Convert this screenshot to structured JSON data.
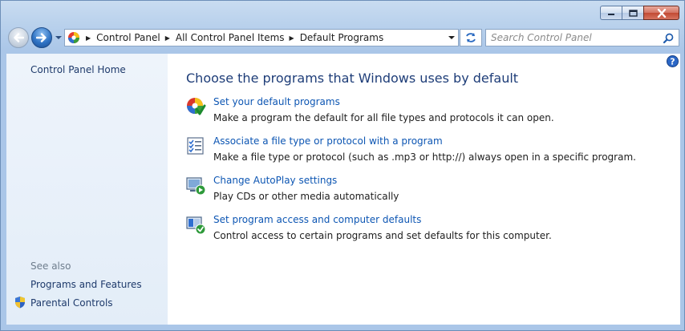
{
  "window": {
    "caption": {
      "minimize_icon": "minimize-icon",
      "maximize_icon": "maximize-icon",
      "close_icon": "close-icon"
    }
  },
  "navigation": {
    "back_icon": "back-arrow-icon",
    "forward_icon": "forward-arrow-icon",
    "recent_icon": "chevron-down-icon"
  },
  "address_bar": {
    "icon": "control-panel-icon",
    "breadcrumbs": [
      "Control Panel",
      "All Control Panel Items",
      "Default Programs"
    ]
  },
  "search": {
    "placeholder": "Search Control Panel",
    "value": ""
  },
  "sidebar": {
    "home_link": "Control Panel Home",
    "see_also_label": "See also",
    "see_also_links": [
      "Programs and Features",
      "Parental Controls"
    ]
  },
  "main": {
    "heading": "Choose the programs that Windows uses by default",
    "tasks": [
      {
        "link": "Set your default programs",
        "description": "Make a program the default for all file types and protocols it can open.",
        "icon": "default-programs-icon"
      },
      {
        "link": "Associate a file type or protocol with a program",
        "description": "Make a file type or protocol (such as .mp3 or http://) always open in a specific program.",
        "icon": "file-association-icon"
      },
      {
        "link": "Change AutoPlay settings",
        "description": "Play CDs or other media automatically",
        "icon": "autoplay-icon"
      },
      {
        "link": "Set program access and computer defaults",
        "description": "Control access to certain programs and set defaults for this computer.",
        "icon": "program-access-icon"
      }
    ]
  },
  "colors": {
    "link": "#0d56b3",
    "heading": "#1e3d78",
    "frame": "#b9d1ec"
  }
}
